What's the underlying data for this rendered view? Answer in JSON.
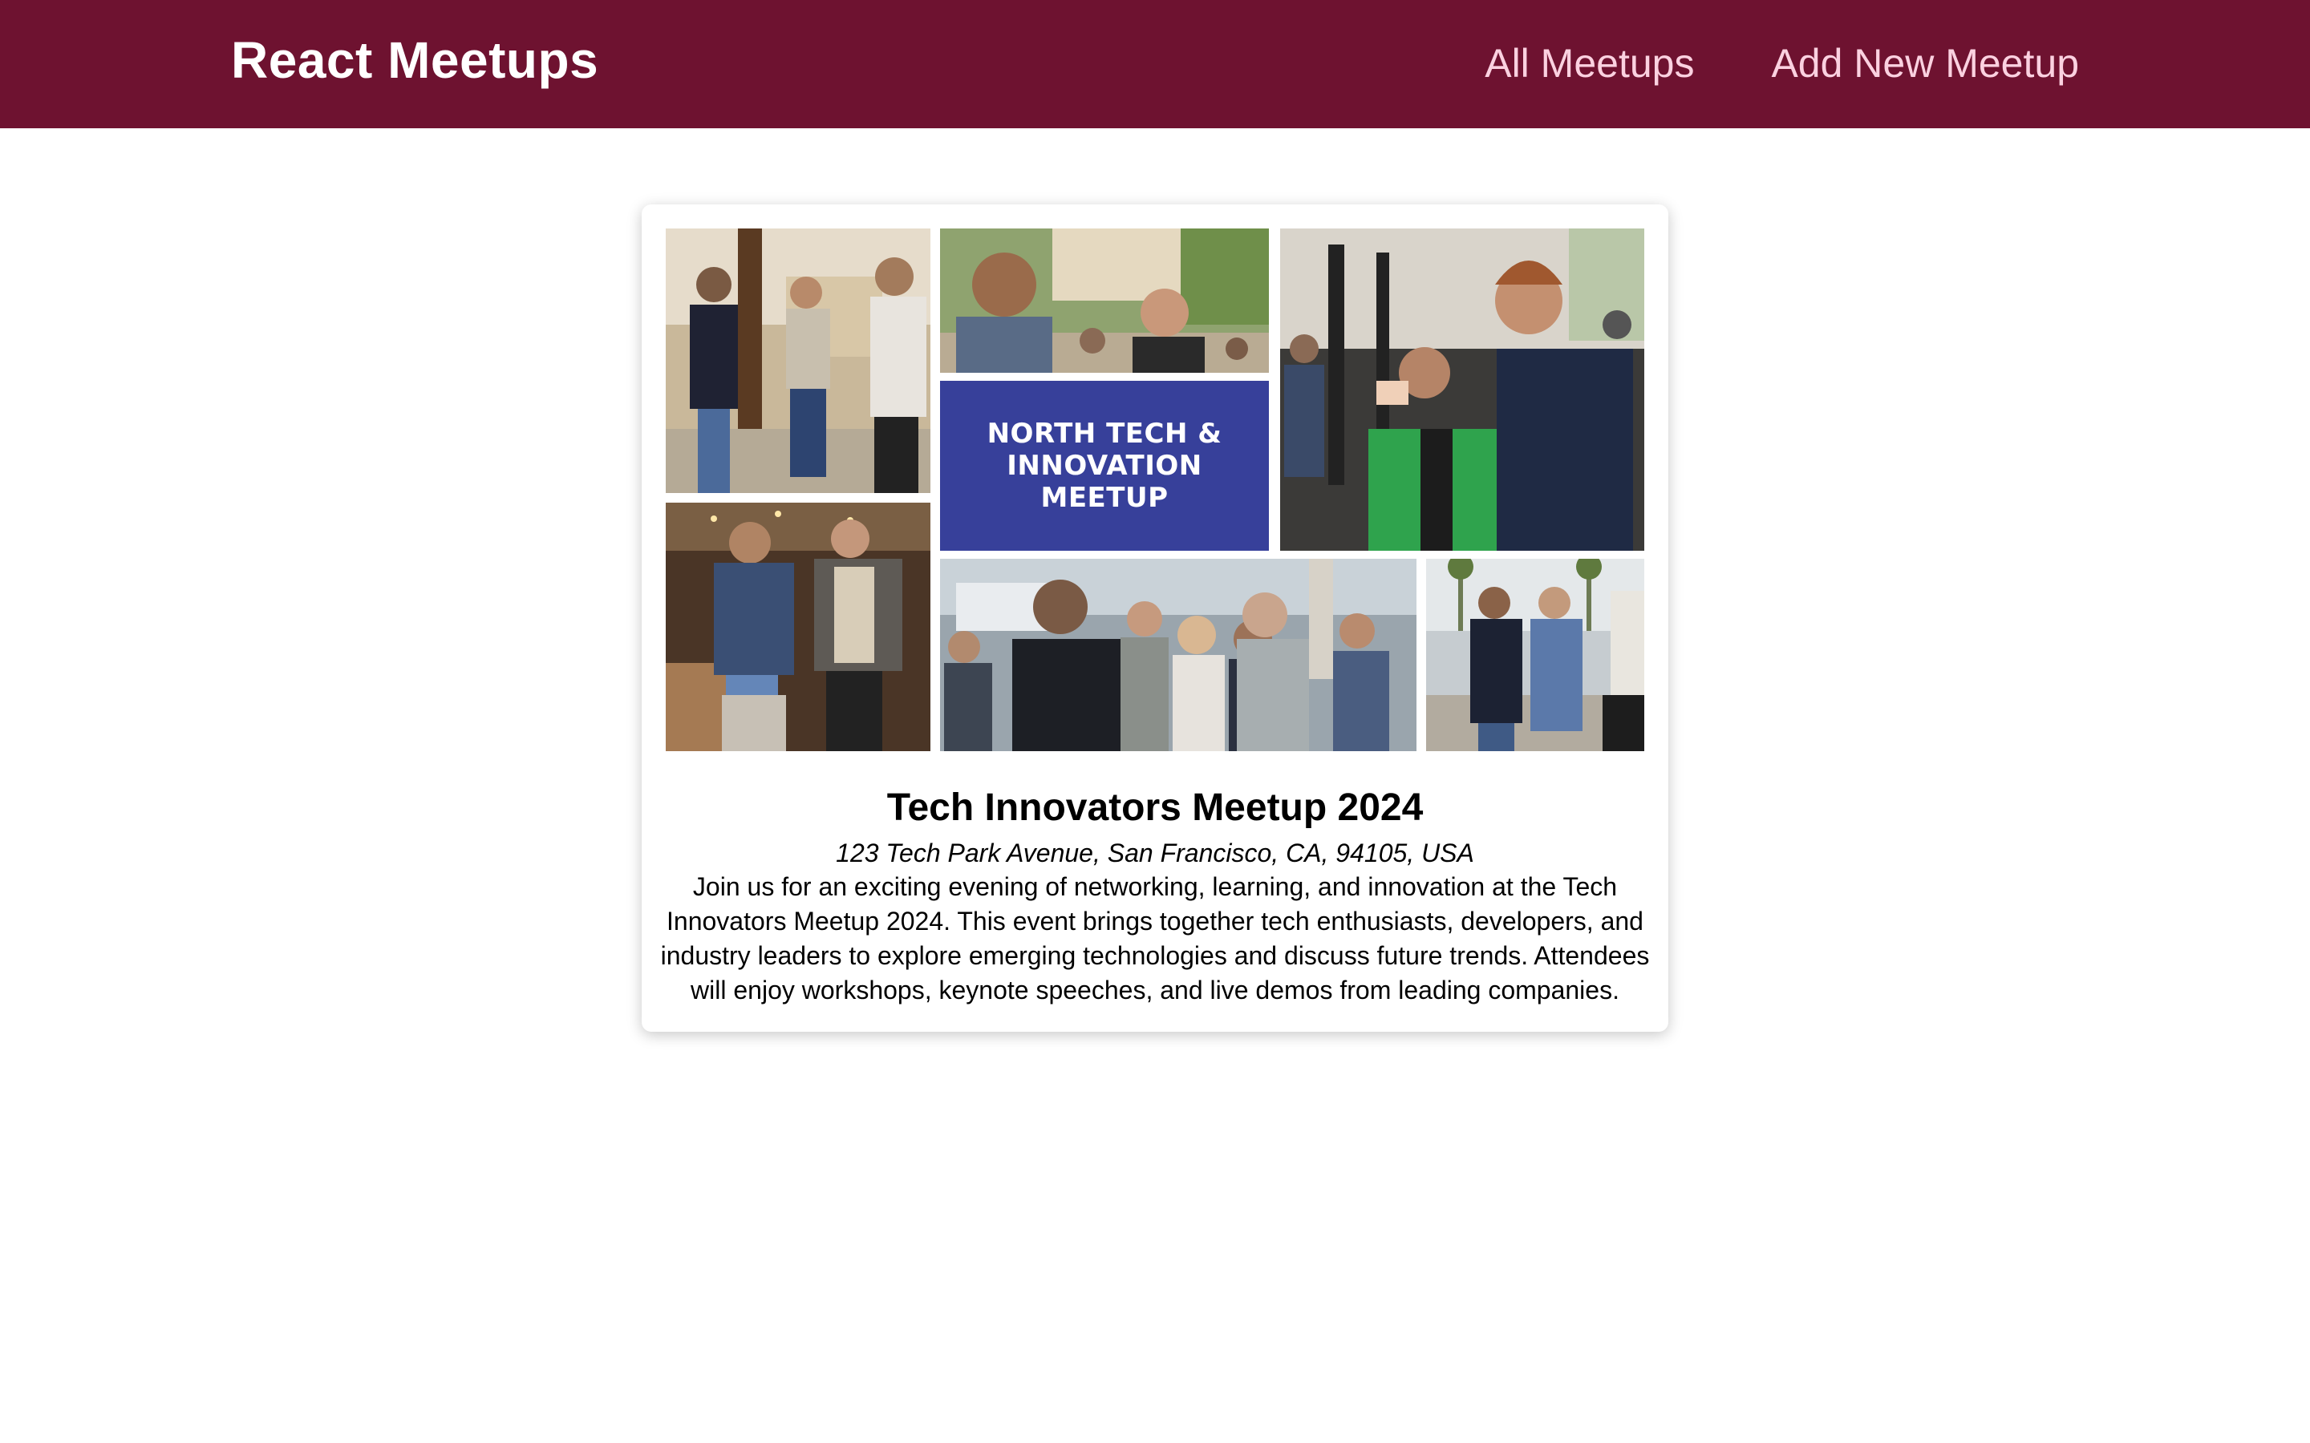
{
  "header": {
    "logo": "React Meetups",
    "nav": [
      {
        "label": "All Meetups"
      },
      {
        "label": "Add New Meetup"
      }
    ]
  },
  "meetup": {
    "image": {
      "banner_text": "NORTH TECH & INNOVATION MEETUP"
    },
    "title": "Tech Innovators Meetup 2024",
    "address": "123 Tech Park Avenue, San Francisco, CA, 94105, USA",
    "description": "Join us for an exciting evening of networking, learning, and innovation at the Tech Innovators Meetup 2024. This event brings together tech enthusiasts, developers, and industry leaders to explore emerging technologies and discuss future trends. Attendees will enjoy workshops, keynote speeches, and live demos from leading companies."
  },
  "colors": {
    "header_bg": "#6e1230",
    "nav_link": "#fbd1e0",
    "banner_bg": "#37409a"
  }
}
